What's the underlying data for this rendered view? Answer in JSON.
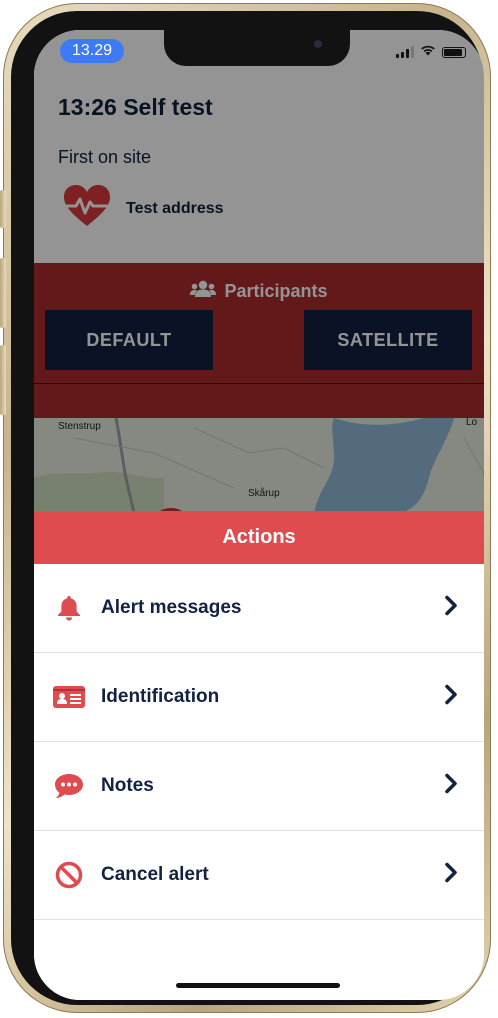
{
  "status_bar": {
    "time": "13.29"
  },
  "header": {
    "title": "13:26 Self test",
    "subtitle": "First on site",
    "address": "Test address"
  },
  "participants": {
    "label": "Participants",
    "tabs": [
      {
        "label": "DEFAULT"
      },
      {
        "label": "SATELLITE"
      }
    ]
  },
  "map": {
    "labels": [
      "Stenstrup",
      "Skårup",
      "Lo"
    ]
  },
  "actions": {
    "title": "Actions",
    "items": [
      {
        "label": "Alert messages",
        "icon": "bell-icon"
      },
      {
        "label": "Identification",
        "icon": "id-card-icon"
      },
      {
        "label": "Notes",
        "icon": "comment-icon"
      },
      {
        "label": "Cancel alert",
        "icon": "ban-icon"
      }
    ]
  },
  "colors": {
    "accent_red": "#de4c4f",
    "participants_red": "#ab2c2e",
    "navy": "#122240"
  }
}
